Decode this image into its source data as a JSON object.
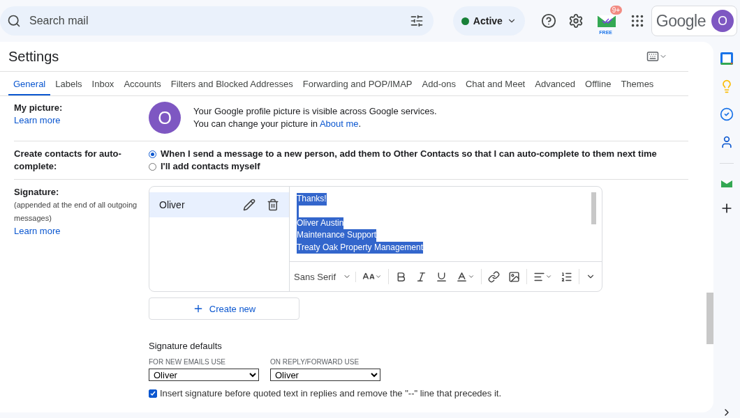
{
  "search": {
    "placeholder": "Search mail"
  },
  "status": {
    "label": "Active",
    "online": true
  },
  "addon": {
    "badge": "9+",
    "tag": "FREE"
  },
  "account": {
    "logo": "Google",
    "avatar": "O"
  },
  "settings": {
    "title": "Settings"
  },
  "tabs": [
    {
      "label": "General",
      "selected": true
    },
    {
      "label": "Labels",
      "selected": false
    },
    {
      "label": "Inbox",
      "selected": false
    },
    {
      "label": "Accounts",
      "selected": false
    },
    {
      "label": "Filters and Blocked Addresses",
      "selected": false
    },
    {
      "label": "Forwarding and POP/IMAP",
      "selected": false
    },
    {
      "label": "Add-ons",
      "selected": false
    },
    {
      "label": "Chat and Meet",
      "selected": false
    },
    {
      "label": "Advanced",
      "selected": false
    },
    {
      "label": "Offline",
      "selected": false
    },
    {
      "label": "Themes",
      "selected": false
    }
  ],
  "my_picture": {
    "label": "My picture:",
    "link": "Learn more",
    "avatar": "O",
    "line_1": "Your Google profile picture is visible across Google services.",
    "line_2_text": "You can change your picture in ",
    "line_2_link": "About me",
    "line_2_end": "."
  },
  "autocomplete": {
    "label": "Create contacts for auto-complete:",
    "options": [
      {
        "label": "When I send a message to a new person, add them to Other Contacts so that I can auto-complete to them next time",
        "selected": true
      },
      {
        "label": "I'll add contacts myself",
        "selected": false
      }
    ]
  },
  "signature": {
    "label": "Signature:",
    "note": "(appended at the end of all outgoing messages)",
    "link": "Learn more",
    "signatures": [
      {
        "name": "Oliver",
        "selected": true
      }
    ],
    "editor": {
      "highlighted": true,
      "lines": [
        {
          "text": "Thanks!",
          "gap_before": false
        },
        {
          "text": "Oliver Austin",
          "gap_before": true
        },
        {
          "text": "Maintenance Support",
          "gap_before": false
        },
        {
          "text": "Treaty Oak Property Management",
          "gap_before": false
        }
      ],
      "font": "Sans Serif"
    },
    "create_new": "Create new",
    "defaults_title": "Signature defaults",
    "new_emails": {
      "label": "FOR NEW EMAILS USE",
      "value": "Oliver"
    },
    "reply_forward": {
      "label": "ON REPLY/FORWARD USE",
      "value": "Oliver"
    },
    "insert_before": {
      "label": "Insert signature before quoted text in replies and remove the \"--\" line that precedes it.",
      "checked": true
    }
  }
}
